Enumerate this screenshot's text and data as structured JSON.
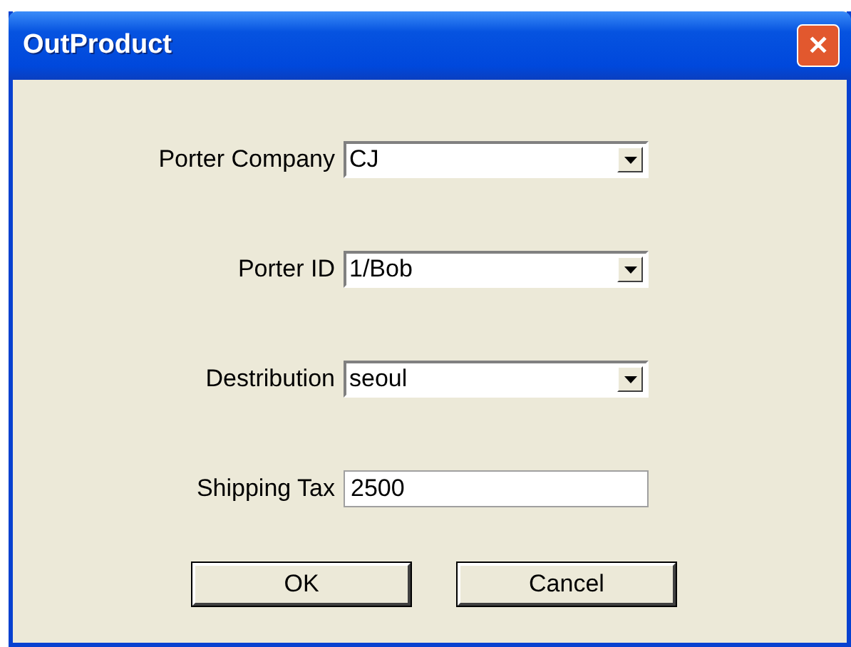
{
  "window": {
    "title": "OutProduct",
    "close": "✕"
  },
  "fields": [
    {
      "label": "Porter Company",
      "kind": "dropdown",
      "value": "CJ"
    },
    {
      "label": "Porter ID",
      "kind": "dropdown",
      "value": "1/Bob"
    },
    {
      "label": "Destribution",
      "kind": "dropdown",
      "value": "seoul"
    },
    {
      "label": "Shipping Tax",
      "kind": "text",
      "value": "2500"
    }
  ],
  "buttons": [
    "OK",
    "Cancel"
  ]
}
